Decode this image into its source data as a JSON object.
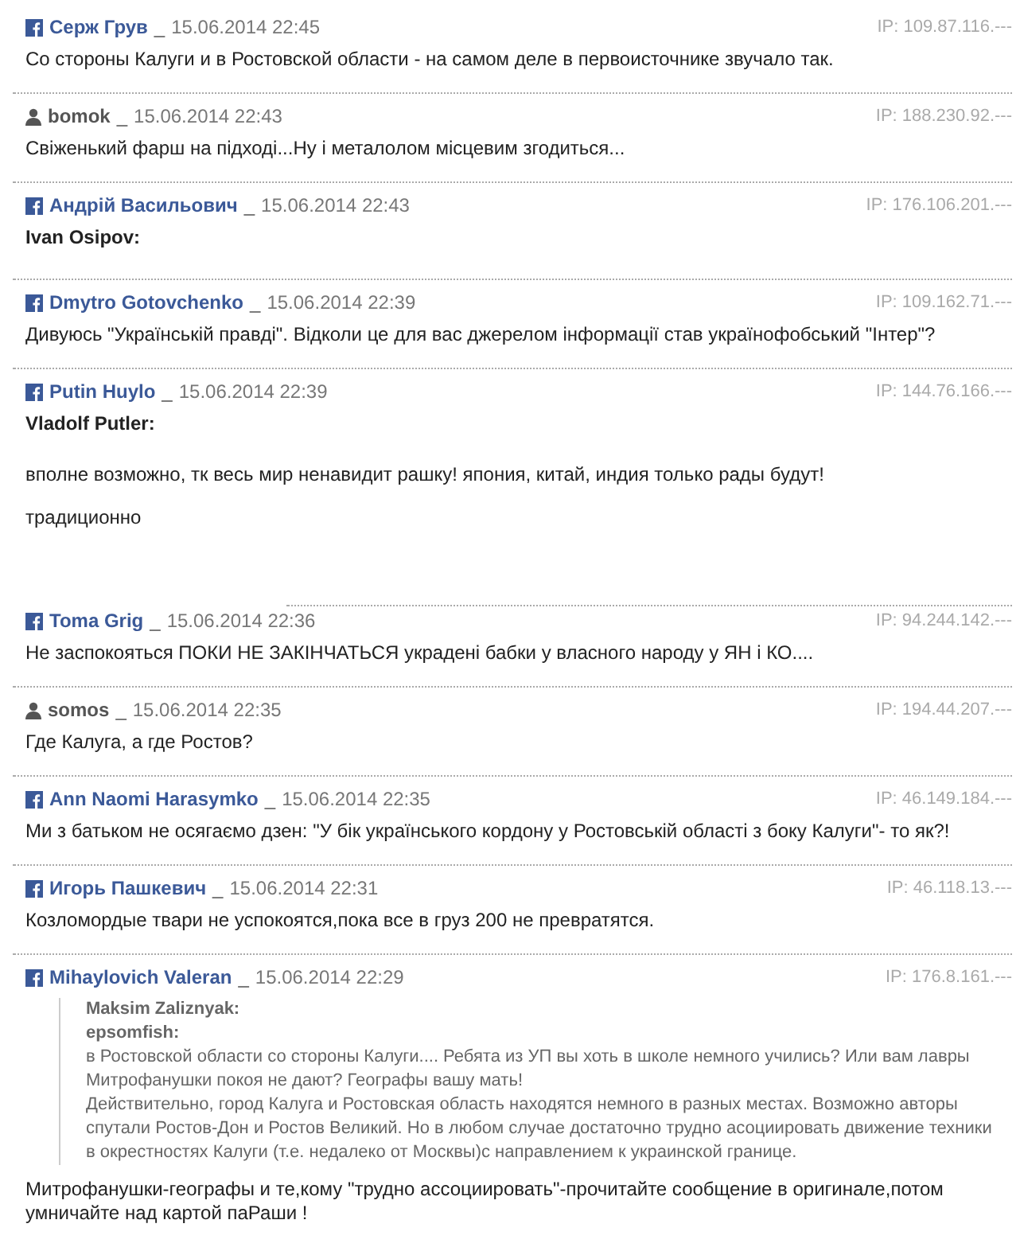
{
  "comments": [
    {
      "kind": "facebook",
      "author": "Серж Грув",
      "separator": "_",
      "date": "15.06.2014 22:45",
      "ip": "IP: 109.87.116.---",
      "divider": {
        "kind": "full"
      },
      "body": [
        {
          "kind": "text",
          "text": "Со стороны Калуги и в Ростовской области - на самом деле в первоисточнике звучало так."
        }
      ]
    },
    {
      "kind": "user",
      "author": "bomok",
      "separator": "_",
      "date": "15.06.2014 22:43",
      "ip": "IP: 188.230.92.---",
      "divider": {
        "kind": "full"
      },
      "body": [
        {
          "kind": "text",
          "text": "Свіженький фарш на підході...Ну і металолом місцевим згодиться..."
        }
      ]
    },
    {
      "kind": "facebook",
      "author": "Андрій Васильович",
      "separator": "_",
      "date": "15.06.2014 22:43",
      "ip": "IP: 176.106.201.---",
      "divider": {
        "kind": "full"
      },
      "body": [
        {
          "kind": "bold",
          "text": "Ivan Osipov:"
        }
      ]
    },
    {
      "kind": "facebook",
      "author": "Dmytro Gotovchenko",
      "separator": "_",
      "date": "15.06.2014 22:39",
      "ip": "IP: 109.162.71.---",
      "divider": {
        "kind": "full"
      },
      "body": [
        {
          "kind": "text",
          "text": "Дивуюсь \"Українській правді\". Відколи це для вас джерелом інформації став українофобський \"Інтер\"?"
        }
      ]
    },
    {
      "kind": "facebook",
      "author": "Putin Huylo",
      "separator": "_",
      "date": "15.06.2014 22:39",
      "ip": "IP: 144.76.166.---",
      "divider": {
        "kind": "short"
      },
      "body": [
        {
          "kind": "bold",
          "text": "Vladolf Putler:"
        },
        {
          "kind": "text",
          "text": "вполне возможно, тк весь мир ненавидит рашку! япония, китай, индия только рады будут!"
        },
        {
          "kind": "text",
          "text": "традиционно"
        }
      ]
    },
    {
      "kind": "facebook",
      "author": "Toma Grig",
      "separator": "_",
      "date": "15.06.2014 22:36",
      "ip": "IP: 94.244.142.---",
      "divider": {
        "kind": "full"
      },
      "body": [
        {
          "kind": "text",
          "text": "Не заспокояться ПОКИ НЕ ЗАКІНЧАТЬСЯ украдені бабки у власного народу у ЯН і КО...."
        }
      ]
    },
    {
      "kind": "user",
      "author": "somos",
      "separator": "_",
      "date": "15.06.2014 22:35",
      "ip": "IP: 194.44.207.---",
      "divider": {
        "kind": "full"
      },
      "body": [
        {
          "kind": "text",
          "text": "Где Калуга, а где Ростов?"
        }
      ]
    },
    {
      "kind": "facebook",
      "author": "Ann Naomi Harasymko",
      "separator": "_",
      "date": "15.06.2014 22:35",
      "ip": "IP: 46.149.184.---",
      "divider": {
        "kind": "full"
      },
      "body": [
        {
          "kind": "text",
          "text": "Ми з батьком не осягаємо дзен: \"У бік українського кордону у Ростовській області з боку Калуги\"- то як?!"
        }
      ]
    },
    {
      "kind": "facebook",
      "author": "Игорь Пашкевич",
      "separator": "_",
      "date": "15.06.2014 22:31",
      "ip": "IP: 46.118.13.---",
      "divider": {
        "kind": "full"
      },
      "body": [
        {
          "kind": "text",
          "text": "Козломордые твари не успокоятся,пока все в груз 200 не превратятся."
        }
      ]
    },
    {
      "kind": "facebook",
      "author": "Mihaylovich Valeran",
      "separator": "_",
      "date": "15.06.2014 22:29",
      "ip": "IP: 176.8.161.---",
      "body": [
        {
          "kind": "quote",
          "lines": [
            {
              "kind": "bold",
              "text": "Maksim Zaliznyak:"
            },
            {
              "kind": "bold",
              "text": "epsomfish:"
            },
            {
              "kind": "text",
              "text": "в Ростовской области со стороны Калуги.... Ребята из УП вы хоть в школе немного учились? Или вам лавры Митрофанушки покоя не дают? Географы вашу мать!"
            },
            {
              "kind": "text",
              "text": "Действительно, город Калуга и Ростовская область находятся немного в разных местах. Возможно авторы спутали Ростов-Дон и Ростов Великий. Но в любом случае достаточно трудно асоциировать движение техники в окрестностях Калуги (т.е. недалеко от Москвы)с направлением к украинской границе."
            }
          ]
        },
        {
          "kind": "text",
          "text": "Митрофанушки-географы и те,кому \"трудно ассоциировать\"-прочитайте сообщение в оригинале,потом умничайте над картой паРаши !"
        }
      ]
    }
  ]
}
